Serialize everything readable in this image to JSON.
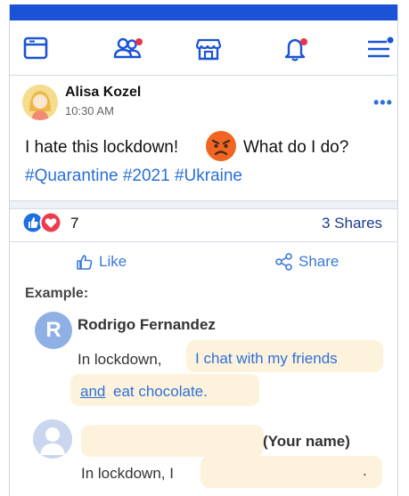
{
  "colors": {
    "brand": "#1a53d6",
    "accent": "#2f6fd8",
    "notification": "#e8344a",
    "highlight": "#fdf2dc"
  },
  "nav": {
    "icons": [
      "window-icon",
      "friends-icon",
      "marketplace-icon",
      "bell-icon",
      "menu-icon"
    ]
  },
  "post": {
    "author": "Alisa Kozel",
    "time": "10:30 AM",
    "more": "•••",
    "text_before": "I hate this lockdown!",
    "emoji": "angry-face-emoji",
    "text_after": "What do I do?",
    "hashtags": "#Quarantine #2021 #Ukraine",
    "reactions_count": "7",
    "shares": "3 Shares"
  },
  "actions": {
    "like": "Like",
    "share": "Share"
  },
  "example": {
    "label": "Example:",
    "avatar_letter": "R",
    "name": "Rodrigo Fernandez",
    "lead": "In lockdown,",
    "answer_line1": "I chat with my friends",
    "answer_and": "and",
    "answer_rest": "eat chocolate."
  },
  "exercise": {
    "your_name_label": "(Your name)",
    "lead": "In lockdown, I",
    "end": "."
  }
}
